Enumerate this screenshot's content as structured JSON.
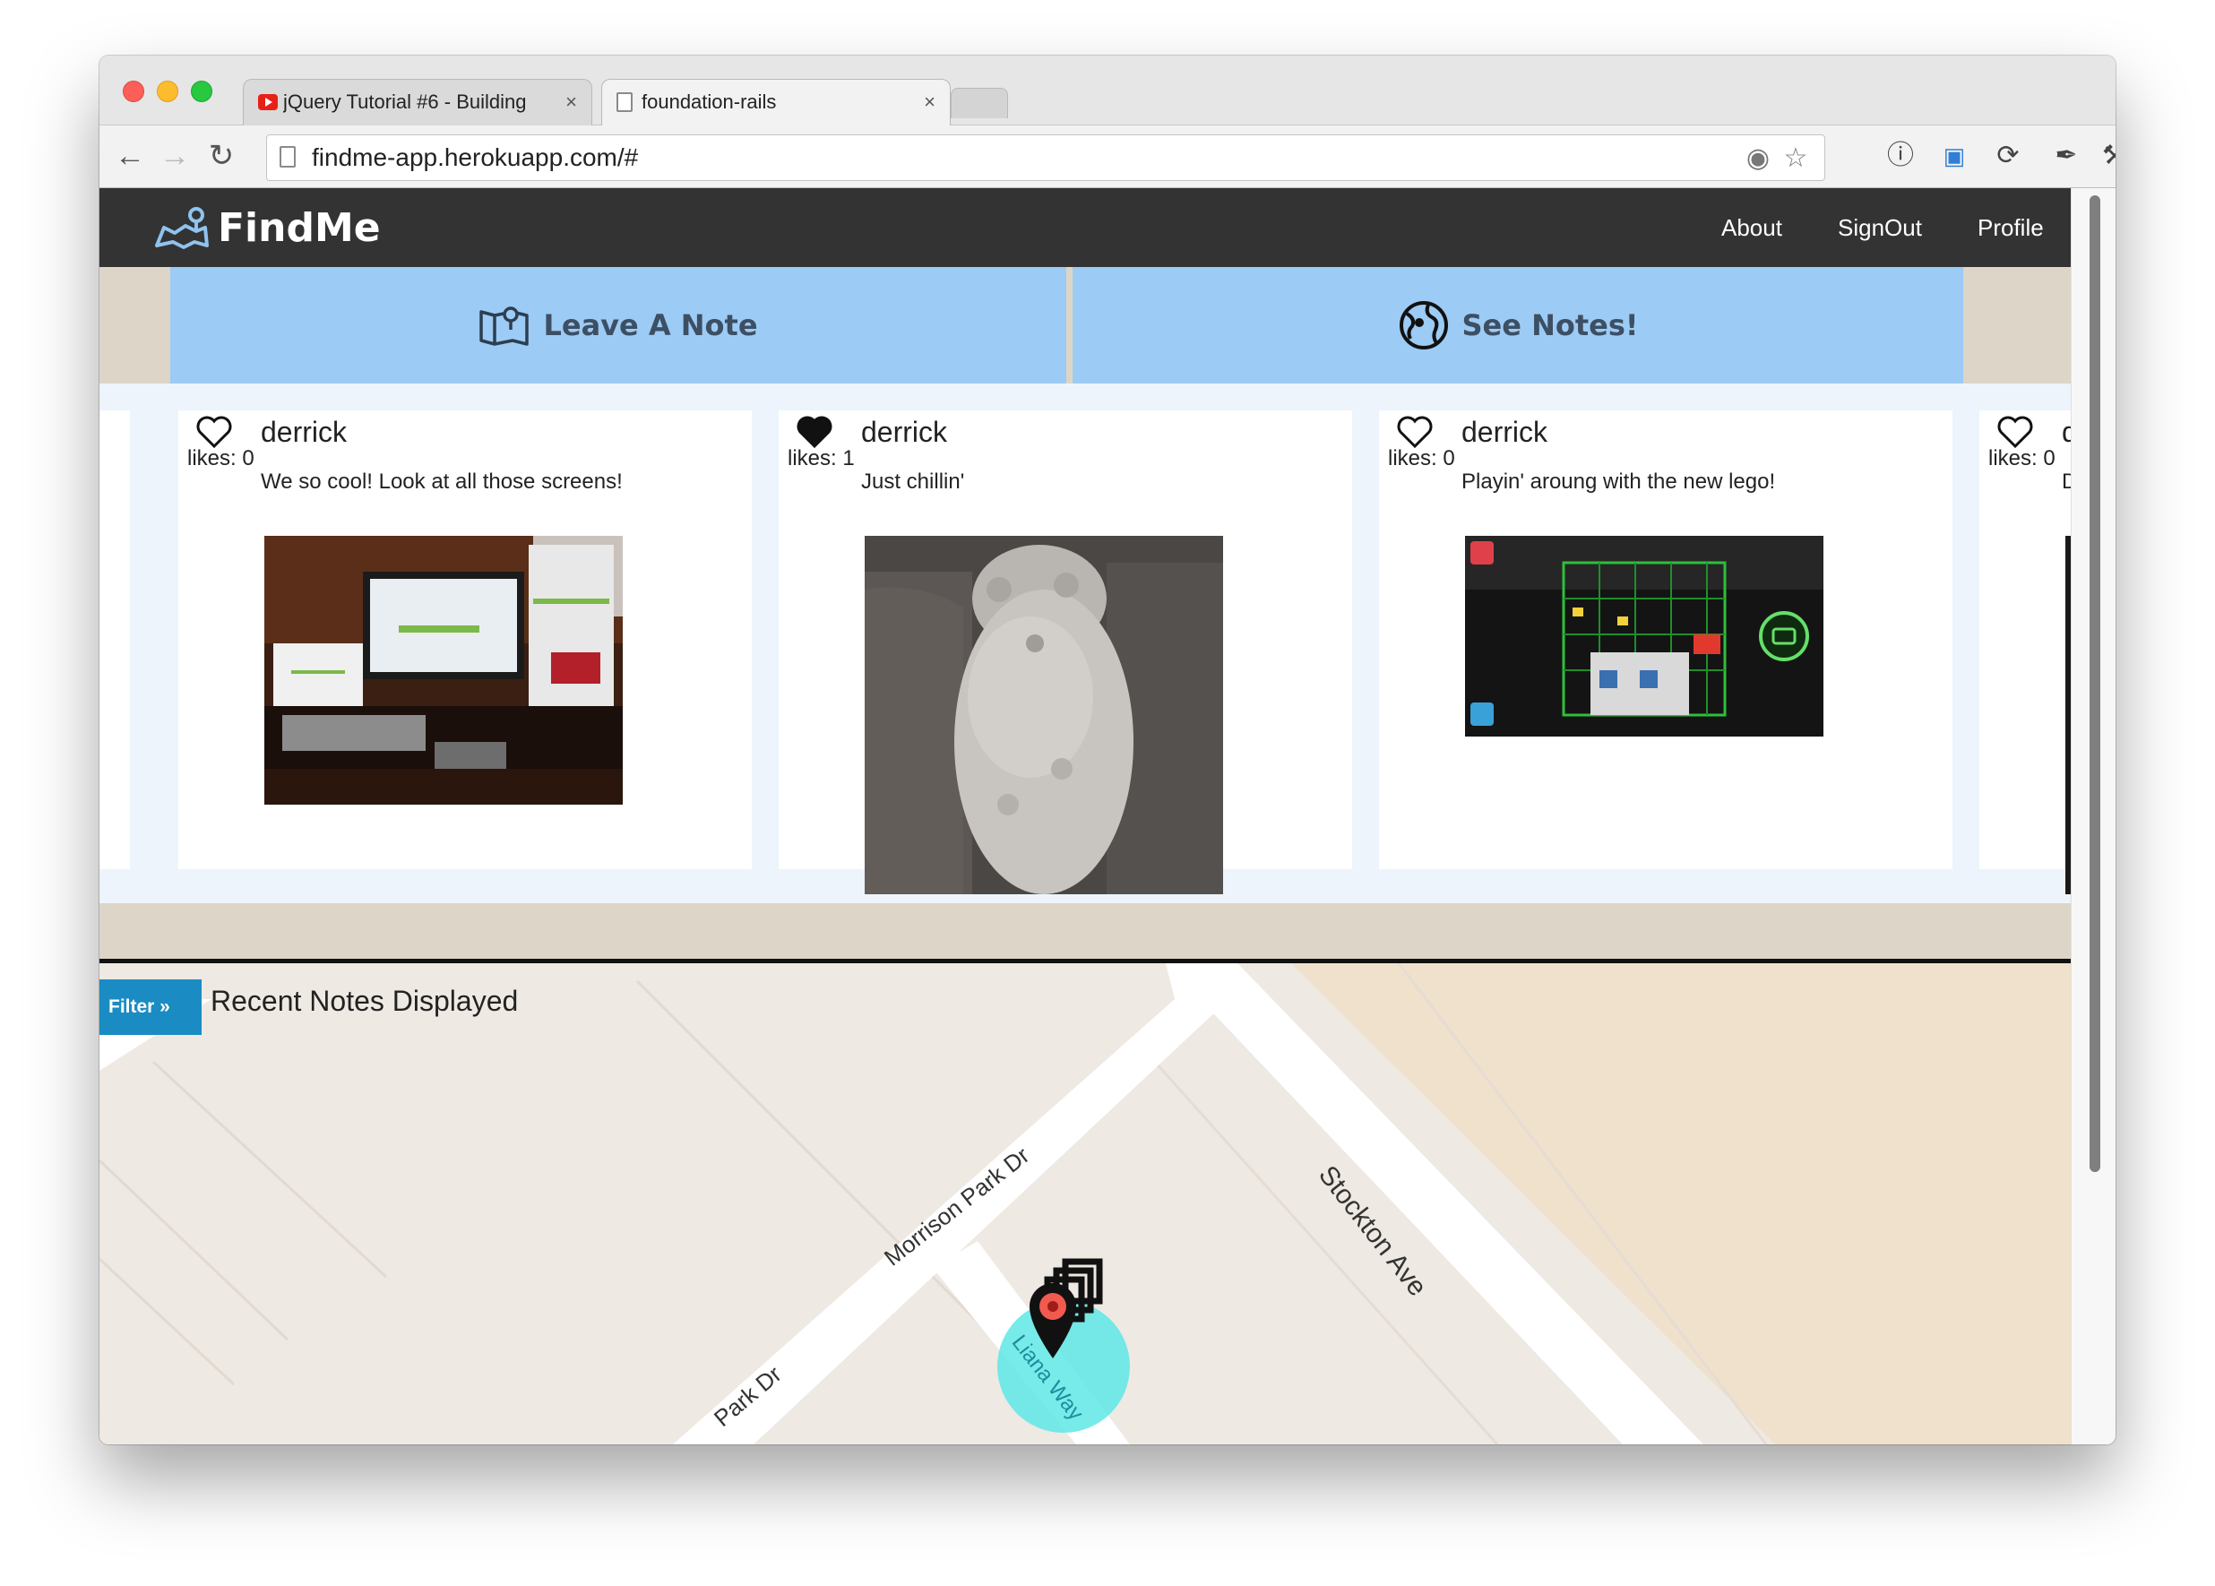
{
  "browser": {
    "tabs": [
      {
        "title": "jQuery Tutorial #6 - Building",
        "close": "×"
      },
      {
        "title": "foundation-rails",
        "close": "×"
      }
    ],
    "url": "findme-app.herokuapp.com/#"
  },
  "app": {
    "brand": "FindMe",
    "nav": {
      "about": "About",
      "signout": "SignOut",
      "profile": "Profile"
    },
    "actions": {
      "leave_note": "Leave A Note",
      "see_notes": "See Notes!"
    }
  },
  "notes": [
    {
      "author": "derrick",
      "likes_label": "likes: 0",
      "message": "We so cool! Look at all those screens!",
      "liked": false
    },
    {
      "author": "derrick",
      "likes_label": "likes: 1",
      "message": "Just chillin'",
      "liked": true
    },
    {
      "author": "derrick",
      "likes_label": "likes: 0",
      "message": "Playin' aroung with the new lego!",
      "liked": false
    },
    {
      "author": "d",
      "likes_label": "likes: 0",
      "message": "D",
      "liked": false
    }
  ],
  "map": {
    "filter_label": "Filter »",
    "title": "Recent Notes Displayed",
    "streets": {
      "morrison": "Morrison Park Dr",
      "stockton": "Stockton Ave",
      "park": "Park Dr",
      "liana": "Liana Way"
    }
  },
  "colors": {
    "navbar": "#333333",
    "action_button": "#9ccbf5",
    "filter_button": "#1a8cc3",
    "page_bg": "#ddd5c8",
    "map_bg": "#efe9e3"
  }
}
